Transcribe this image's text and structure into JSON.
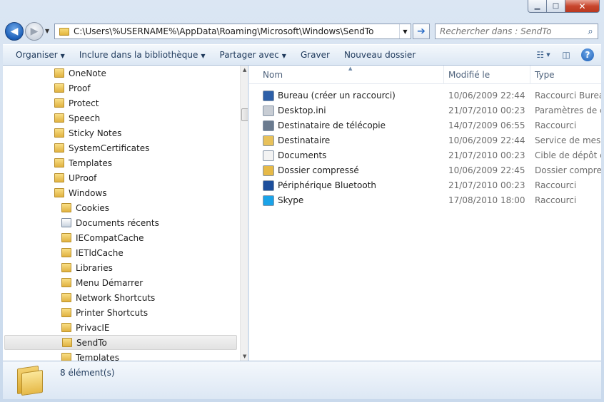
{
  "window": {
    "min_symbol": "▁",
    "max_symbol": "□",
    "close_symbol": "✕"
  },
  "nav": {
    "back_icon": "back-arrow-icon",
    "forward_icon": "forward-arrow-icon",
    "address_path": "C:\\Users\\%USERNAME%\\AppData\\Roaming\\Microsoft\\Windows\\SendTo",
    "search_placeholder": "Rechercher dans : SendTo"
  },
  "toolbar": {
    "organiser": "Organiser",
    "inclure": "Inclure dans la bibliothèque",
    "partager": "Partager avec",
    "graver": "Graver",
    "nouveau_dossier": "Nouveau dossier"
  },
  "tree": [
    {
      "label": "OneNote",
      "level": 1
    },
    {
      "label": "Proof",
      "level": 1
    },
    {
      "label": "Protect",
      "level": 1
    },
    {
      "label": "Speech",
      "level": 1
    },
    {
      "label": "Sticky Notes",
      "level": 1
    },
    {
      "label": "SystemCertificates",
      "level": 1
    },
    {
      "label": "Templates",
      "level": 1
    },
    {
      "label": "UProof",
      "level": 1
    },
    {
      "label": "Windows",
      "level": 1
    },
    {
      "label": "Cookies",
      "level": 2
    },
    {
      "label": "Documents récents",
      "level": 2,
      "special": true
    },
    {
      "label": "IECompatCache",
      "level": 2
    },
    {
      "label": "IETldCache",
      "level": 2
    },
    {
      "label": "Libraries",
      "level": 2
    },
    {
      "label": "Menu Démarrer",
      "level": 2
    },
    {
      "label": "Network Shortcuts",
      "level": 2
    },
    {
      "label": "Printer Shortcuts",
      "level": 2
    },
    {
      "label": "PrivacIE",
      "level": 2
    },
    {
      "label": "SendTo",
      "level": 2,
      "selected": true
    },
    {
      "label": "Templates",
      "level": 2
    }
  ],
  "columns": {
    "name": "Nom",
    "modified": "Modifié le",
    "type": "Type"
  },
  "files": [
    {
      "name": "Bureau (créer un raccourci)",
      "date": "10/06/2009 22:44",
      "type": "Raccourci Bureau",
      "icon": "desktop-icon",
      "color": "#2d5fa8"
    },
    {
      "name": "Desktop.ini",
      "date": "21/07/2010 00:23",
      "type": "Paramètres de co",
      "icon": "settings-file-icon",
      "color": "#c8cdd4"
    },
    {
      "name": "Destinataire de télécopie",
      "date": "14/07/2009 06:55",
      "type": "Raccourci",
      "icon": "fax-icon",
      "color": "#6b7b8f"
    },
    {
      "name": "Destinataire",
      "date": "10/06/2009 22:44",
      "type": "Service de messag",
      "icon": "mail-recipient-icon",
      "color": "#e8c15a"
    },
    {
      "name": "Documents",
      "date": "21/07/2010 00:23",
      "type": "Cible de dépôt de",
      "icon": "documents-icon",
      "color": "#f3f3f3"
    },
    {
      "name": "Dossier compressé",
      "date": "10/06/2009 22:45",
      "type": "Dossier compress",
      "icon": "zip-folder-icon",
      "color": "#e6b947"
    },
    {
      "name": "Périphérique Bluetooth",
      "date": "21/07/2010 00:23",
      "type": "Raccourci",
      "icon": "bluetooth-icon",
      "color": "#1d4f9c"
    },
    {
      "name": "Skype",
      "date": "17/08/2010 18:00",
      "type": "Raccourci",
      "icon": "skype-icon",
      "color": "#1aa3e8"
    }
  ],
  "status": {
    "count": "8 élément(s)"
  }
}
